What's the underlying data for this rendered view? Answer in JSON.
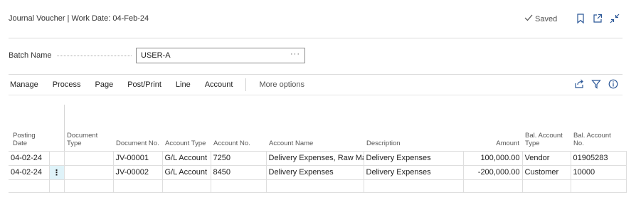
{
  "header": {
    "title": "Journal Voucher | Work Date: 04-Feb-24",
    "saved_label": "Saved"
  },
  "batch": {
    "label": "Batch Name",
    "value": "USER-A"
  },
  "actions": {
    "items": [
      "Manage",
      "Process",
      "Page",
      "Post/Print",
      "Line",
      "Account"
    ],
    "more": "More options"
  },
  "table": {
    "columns": {
      "posting_date": "Posting Date",
      "document_type": "Document Type",
      "document_no": "Document No.",
      "account_type": "Account Type",
      "account_no": "Account No.",
      "account_name": "Account Name",
      "description": "Description",
      "amount": "Amount",
      "bal_account_type": "Bal. Account Type",
      "bal_account_no": "Bal. Account No."
    },
    "rows": [
      {
        "posting_date": "04-02-24",
        "document_type": "",
        "document_no": "JV-00001",
        "account_type": "G/L Account",
        "account_no": "7250",
        "account_name": "Delivery Expenses, Raw Mat.",
        "description": "Delivery Expenses",
        "amount": "100,000.00",
        "bal_account_type": "Vendor",
        "bal_account_no": "01905283"
      },
      {
        "posting_date": "04-02-24",
        "document_type": "",
        "document_no": "JV-00002",
        "account_type": "G/L Account",
        "account_no": "8450",
        "account_name": "Delivery Expenses",
        "description": "Delivery Expenses",
        "amount": "-200,000.00",
        "bal_account_type": "Customer",
        "bal_account_no": "10000"
      }
    ]
  },
  "colors": {
    "accent": "#2b5797",
    "row_menu_bg": "#dff3f9"
  },
  "icons": [
    "checkmark-icon",
    "bookmark-icon",
    "open-new-window-icon",
    "collapse-icon",
    "share-icon",
    "filter-icon",
    "info-icon",
    "row-menu-icon"
  ]
}
